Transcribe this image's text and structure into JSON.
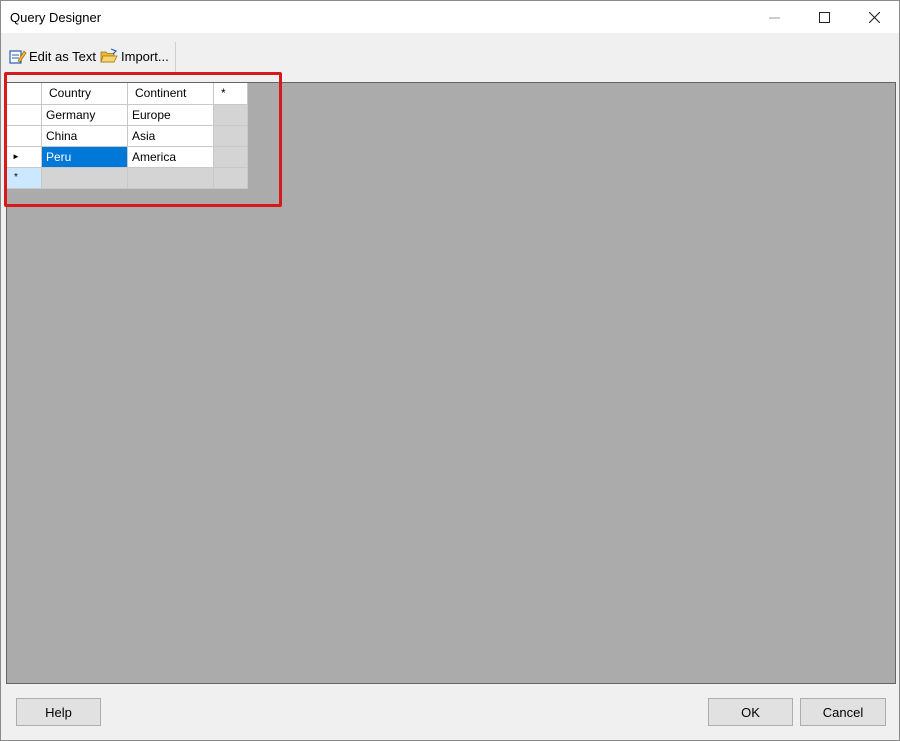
{
  "window": {
    "title": "Query Designer"
  },
  "toolbar": {
    "edit_as_text": "Edit as Text",
    "import": "Import..."
  },
  "grid": {
    "columns": [
      "Country",
      "Continent",
      "*"
    ],
    "rows": [
      [
        "Germany",
        "Europe"
      ],
      [
        "China",
        "Asia"
      ],
      [
        "Peru",
        "America"
      ]
    ],
    "new_row_marker": "*",
    "current_row_marker": "►"
  },
  "footer": {
    "help": "Help",
    "ok": "OK",
    "cancel": "Cancel"
  },
  "colors": {
    "selection": "#0078d7",
    "highlight_border": "#d41a1a",
    "grid_bg": "#ababab"
  }
}
